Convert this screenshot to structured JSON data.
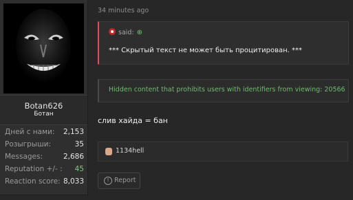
{
  "post": {
    "timestamp": "34 minutes ago",
    "quote": {
      "label": "said:",
      "text": "*** Скрытый текст не может быть процитирован. ***"
    },
    "hidden_notice": "Hidden content that prohibits users with identifiers from viewing: 20566",
    "message": "слив хайда = бан",
    "likes": {
      "user": "1134hell"
    },
    "report_label": "Report"
  },
  "user": {
    "name": "Botan626",
    "title": "Ботан",
    "stats": [
      {
        "label": "Дней с нами:",
        "value": "2,153"
      },
      {
        "label": "Розыгрыши:",
        "value": "35"
      },
      {
        "label": "Messages:",
        "value": "2,686"
      },
      {
        "label": "Reputation +/- :",
        "value": "45"
      },
      {
        "label": "Reaction score:",
        "value": "8,033"
      }
    ]
  },
  "colors": {
    "background": "#272727",
    "quote_accent": "#d9534f",
    "hidden_text": "#6fba6f",
    "reputation": "#7fc97f"
  },
  "icons": [
    "face-avatar-icon",
    "quoted-user-avatar-icon",
    "arrow-up-circle-icon",
    "liker-avatar-icon",
    "report-icon"
  ]
}
